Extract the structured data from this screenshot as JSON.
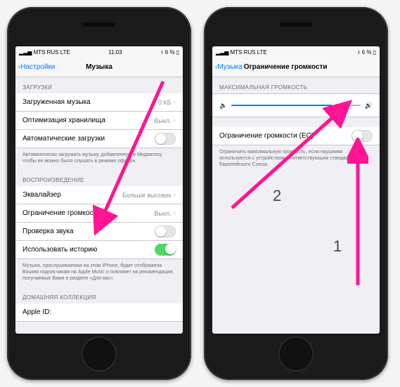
{
  "left": {
    "status": {
      "carrier": "MTS RUS  LTE",
      "time": "11:03",
      "battery": "6 %"
    },
    "nav": {
      "back": "Настройки",
      "title": "Музыка"
    },
    "s_downloads": "ЗАГРУЗКИ",
    "row_downloaded": {
      "label": "Загруженная музыка",
      "value": "0 КБ"
    },
    "row_optimize": {
      "label": "Оптимизация хранилища",
      "value": "Выкл."
    },
    "row_auto": {
      "label": "Автоматические загрузки"
    },
    "note_auto": "Автоматически загружать музыку, добавленную в Медиатеку, чтобы ее можно было слушать в режиме офлайн.",
    "s_playback": "ВОСПРОИЗВЕДЕНИЕ",
    "row_eq": {
      "label": "Эквалайзер",
      "value": "Больше высоких"
    },
    "row_limit": {
      "label": "Ограничение громкости",
      "value": "Выкл."
    },
    "row_check": {
      "label": "Проверка звука"
    },
    "row_hist": {
      "label": "Использовать историю"
    },
    "note_hist": "Музыка, прослушиваемая на этом iPhone, будет отображена Вашим подписчикам на Apple Music и повлияет на рекомендации, получаемые Вами в разделе «Для вас».",
    "s_home": "ДОМАШНЯЯ КОЛЛЕКЦИЯ",
    "row_appleid": {
      "label": "Apple ID:"
    }
  },
  "right": {
    "status": {
      "carrier": "MTS RUS  LTE",
      "time": "",
      "battery": "6 %"
    },
    "nav": {
      "back": "Музыка",
      "title": "Ограничение громкости"
    },
    "s_max": "МАКСИМАЛЬНАЯ ГРОМКОСТЬ",
    "slider_pct": 82,
    "row_ec": {
      "label": "Ограничение громкости (ЕС)"
    },
    "note_ec": "Ограничить максимальную громкость, если наушники используются с устройством, соответствующим стандартам Европейского Союза."
  },
  "annotations": {
    "num1": "1",
    "num2": "2"
  }
}
